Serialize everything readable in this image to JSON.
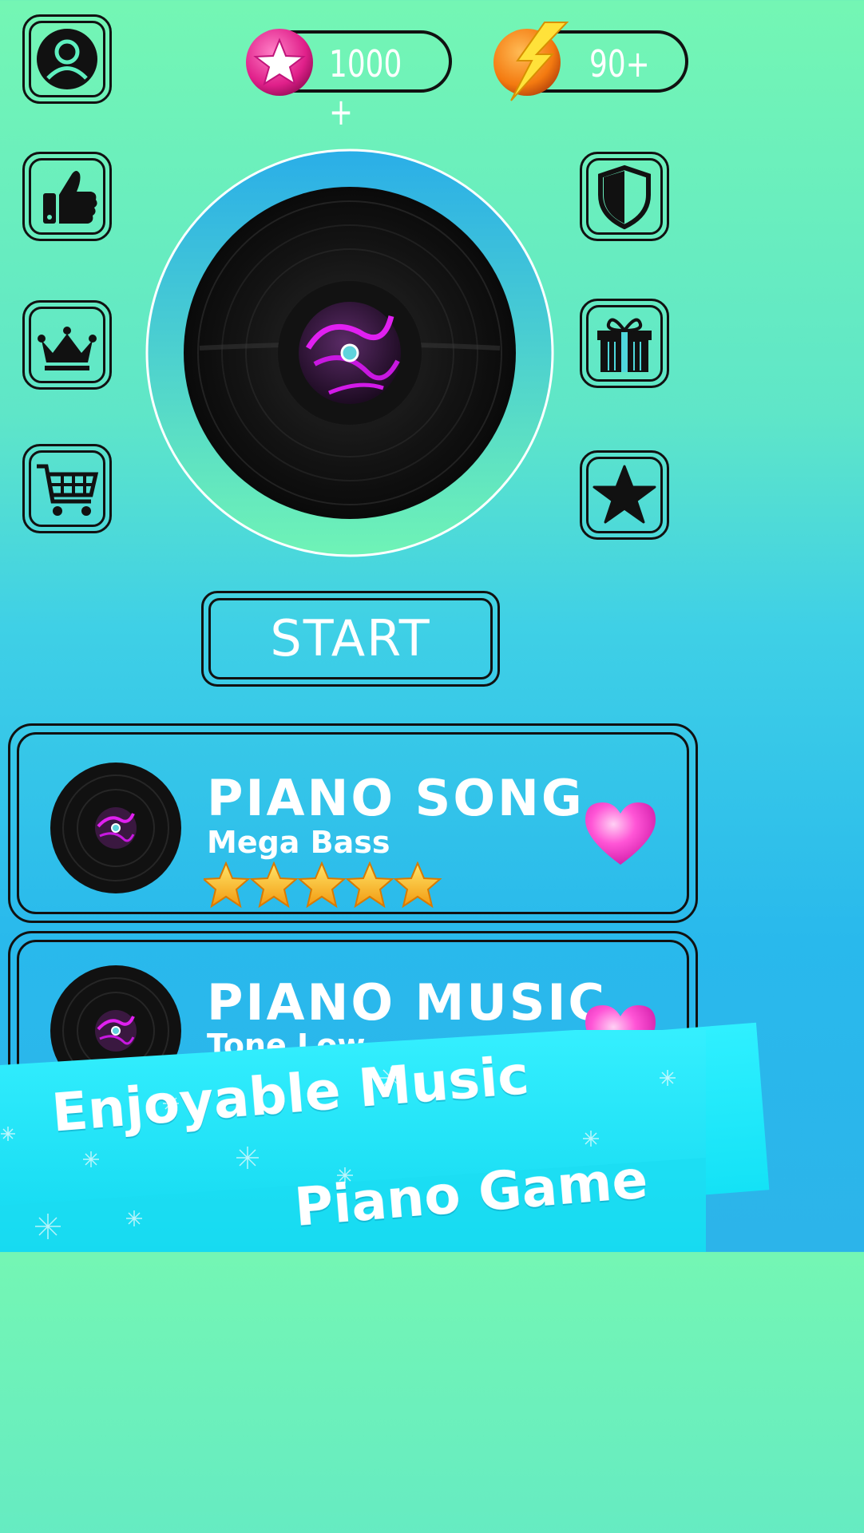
{
  "currency": {
    "stars_value": "1000 +",
    "energy_value": "90+"
  },
  "colors": {
    "text": "#ffffff",
    "outline": "#111111",
    "star_badge": "#e0208a",
    "energy_badge": "#f47a10",
    "heart": "#ff4fd2",
    "rating_star": "#f7b21b",
    "ring": "#36b2e8",
    "banner": "#1ee6f8"
  },
  "left_buttons": [
    {
      "icon": "user-icon"
    },
    {
      "icon": "thumbs-up-icon"
    },
    {
      "icon": "crown-icon"
    },
    {
      "icon": "shopping-cart-icon"
    }
  ],
  "right_buttons": [
    {
      "icon": "shield-icon"
    },
    {
      "icon": "gift-icon"
    },
    {
      "icon": "star-icon"
    }
  ],
  "start": {
    "label": "START"
  },
  "songs": [
    {
      "title": "PIANO SONG",
      "subtitle": "Mega Bass",
      "rating": 5,
      "favorite": true
    },
    {
      "title": "PIANO MUSIC",
      "subtitle": "Tone Low",
      "favorite": true
    }
  ],
  "banner": {
    "line1": "Enjoyable Music",
    "line2": "Piano Game"
  }
}
